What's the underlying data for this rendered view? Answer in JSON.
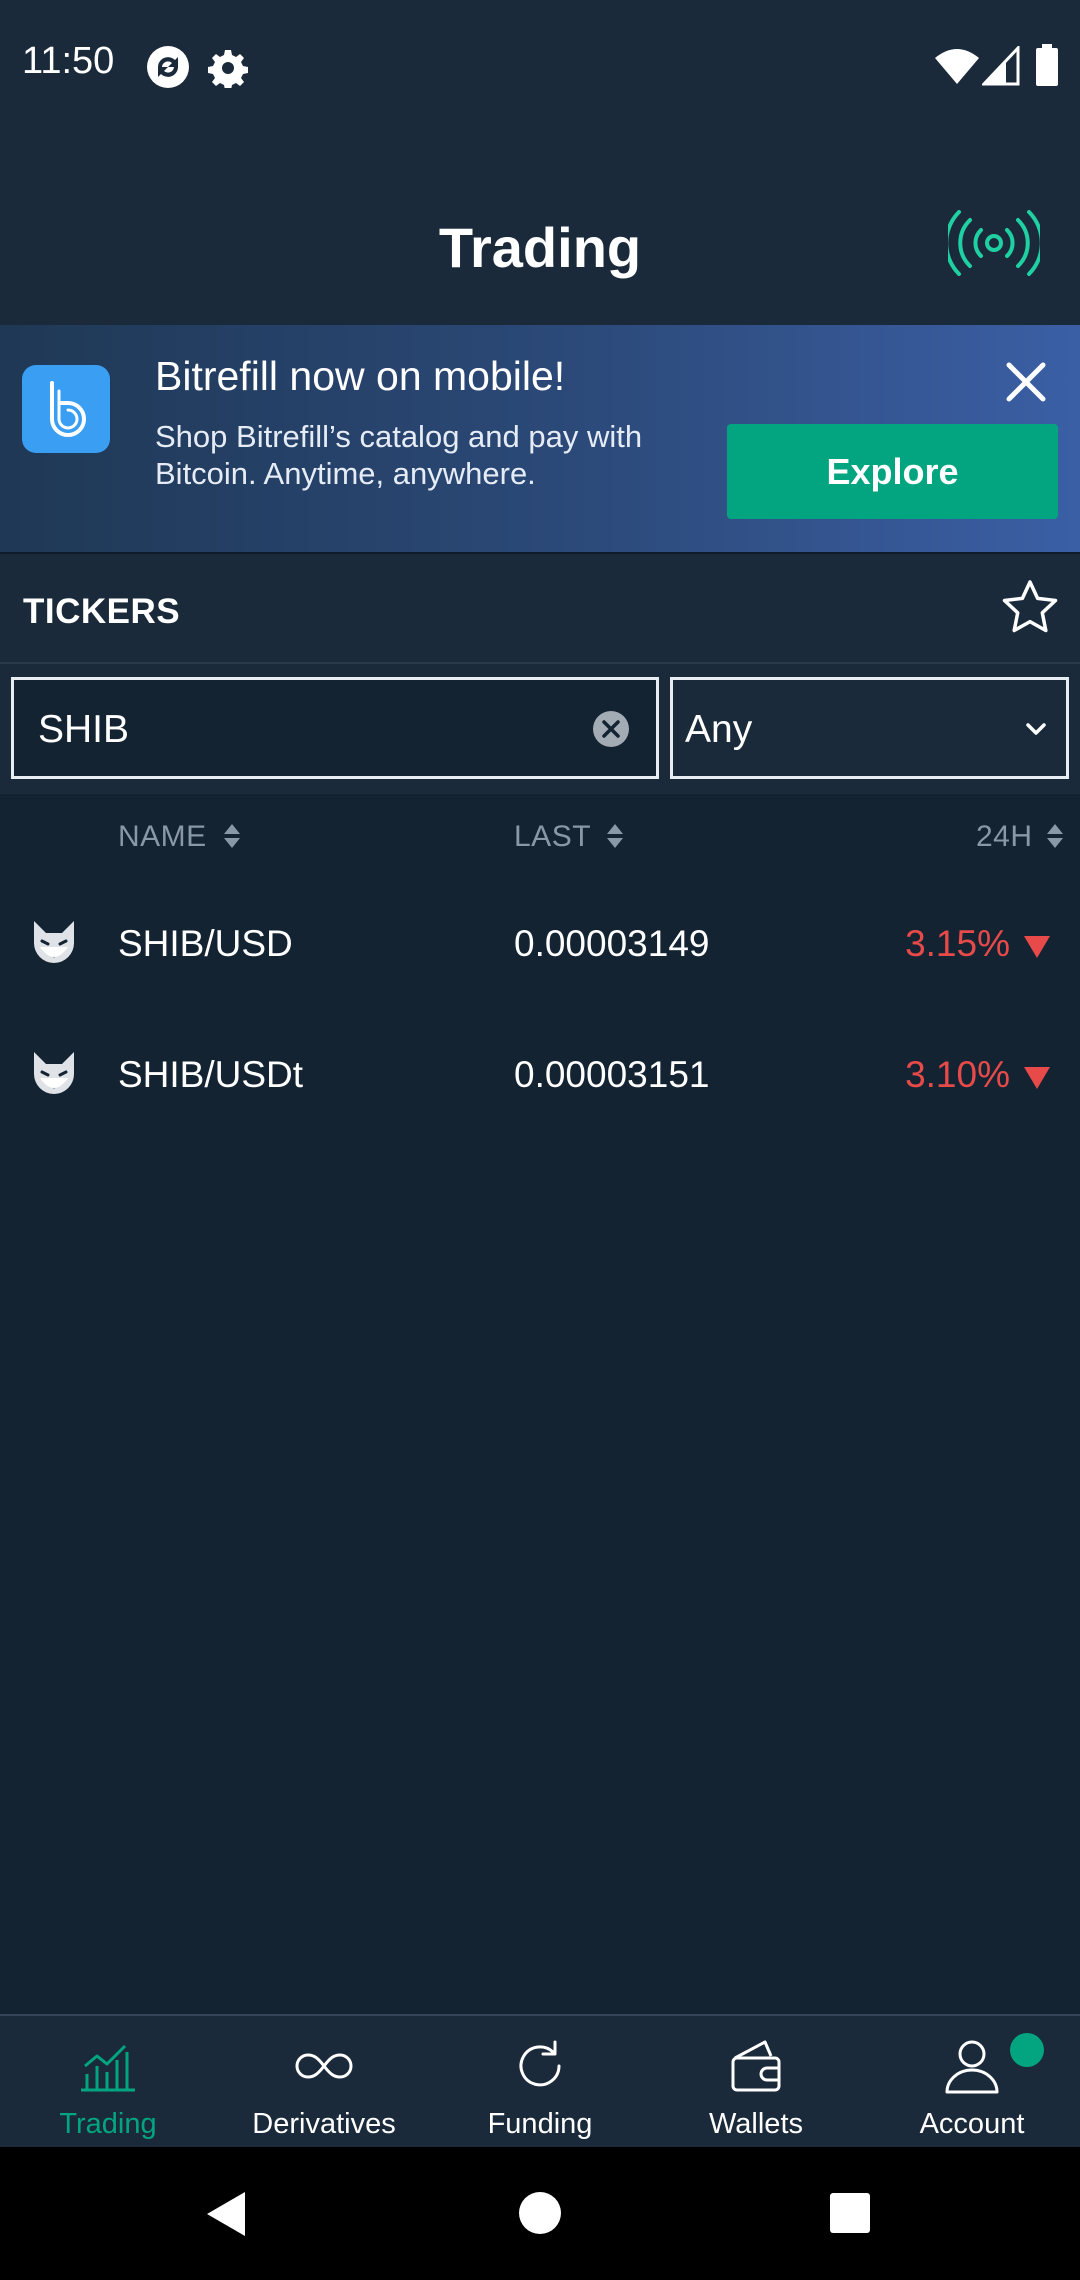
{
  "status_bar": {
    "time": "11:50",
    "icons": [
      "sync-icon",
      "gear-icon",
      "wifi-icon",
      "signal-icon",
      "battery-icon"
    ]
  },
  "header": {
    "title": "Trading",
    "icon": "broadcast-icon"
  },
  "banner": {
    "title": "Bitrefill now on mobile!",
    "text": "Shop Bitrefill’s catalog and pay with Bitcoin. Anytime, anywhere.",
    "button_label": "Explore",
    "close_icon": "close-icon"
  },
  "tickers": {
    "title": "TICKERS",
    "search_value": "SHIB",
    "filter_value": "Any",
    "columns": {
      "name": "NAME",
      "last": "LAST",
      "change": "24H"
    },
    "rows": [
      {
        "name": "SHIB/USD",
        "last": "0.00003149",
        "change": "3.15%",
        "direction": "down"
      },
      {
        "name": "SHIB/USDt",
        "last": "0.00003151",
        "change": "3.10%",
        "direction": "down"
      }
    ]
  },
  "bottom_nav": {
    "items": [
      {
        "label": "Trading",
        "icon": "chart-icon",
        "active": true
      },
      {
        "label": "Derivatives",
        "icon": "infinity-icon",
        "active": false
      },
      {
        "label": "Funding",
        "icon": "refresh-icon",
        "active": false
      },
      {
        "label": "Wallets",
        "icon": "wallet-icon",
        "active": false
      },
      {
        "label": "Account",
        "icon": "user-icon",
        "active": false
      }
    ]
  },
  "colors": {
    "background": "#132332",
    "header": "#1b2a3a",
    "accent": "#02a57f",
    "negative": "#e84a4a"
  }
}
